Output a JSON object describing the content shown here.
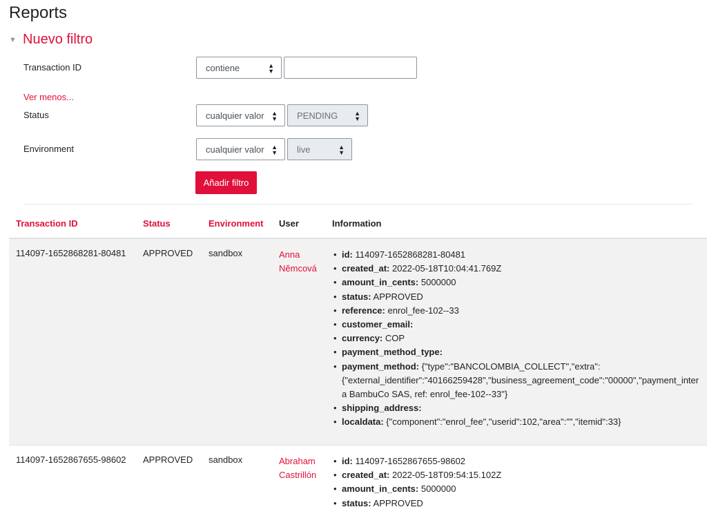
{
  "page": {
    "title": "Reports"
  },
  "filter": {
    "section_title": "Nuevo filtro",
    "transaction_id": {
      "label": "Transaction ID",
      "operator": "contiene",
      "value": ""
    },
    "show_less": "Ver menos...",
    "status": {
      "label": "Status",
      "operator": "cualquier valor",
      "value": "PENDING"
    },
    "environment": {
      "label": "Environment",
      "operator": "cualquier valor",
      "value": "live"
    },
    "add_button": "Añadir filtro"
  },
  "table": {
    "headers": {
      "transaction_id": "Transaction ID",
      "status": "Status",
      "environment": "Environment",
      "user": "User",
      "information": "Information"
    },
    "rows": [
      {
        "transaction_id": "114097-1652868281-80481",
        "status": "APPROVED",
        "environment": "sandbox",
        "user_first": "Anna",
        "user_last": "Němcová",
        "info": {
          "id": {
            "k": "id:",
            "v": " 114097-1652868281-80481"
          },
          "created_at": {
            "k": "created_at:",
            "v": " 2022-05-18T10:04:41.769Z"
          },
          "amount_in_cents": {
            "k": "amount_in_cents:",
            "v": " 5000000"
          },
          "status": {
            "k": "status:",
            "v": " APPROVED"
          },
          "reference": {
            "k": "reference:",
            "v": " enrol_fee-102--33"
          },
          "customer_email": {
            "k": "customer_email:",
            "v": ""
          },
          "currency": {
            "k": "currency:",
            "v": " COP"
          },
          "payment_method_type": {
            "k": "payment_method_type:",
            "v": ""
          },
          "payment_method": {
            "k": "payment_method:",
            "v": " {\"type\":\"BANCOLOMBIA_COLLECT\",\"extra\":"
          },
          "payment_method_line2": "{\"external_identifier\":\"40166259428\",\"business_agreement_code\":\"00000\",\"payment_inter",
          "payment_method_line3": "a BambuCo SAS, ref: enrol_fee-102--33\"}",
          "shipping_address": {
            "k": "shipping_address:",
            "v": ""
          },
          "localdata": {
            "k": "localdata:",
            "v": " {\"component\":\"enrol_fee\",\"userid\":102,\"area\":\"\",\"itemid\":33}"
          }
        }
      },
      {
        "transaction_id": "114097-1652867655-98602",
        "status": "APPROVED",
        "environment": "sandbox",
        "user_first": "Abraham",
        "user_last": "Castrillón",
        "info": {
          "id": {
            "k": "id:",
            "v": " 114097-1652867655-98602"
          },
          "created_at": {
            "k": "created_at:",
            "v": " 2022-05-18T09:54:15.102Z"
          },
          "amount_in_cents": {
            "k": "amount_in_cents:",
            "v": " 5000000"
          },
          "status": {
            "k": "status:",
            "v": " APPROVED"
          }
        }
      }
    ]
  }
}
